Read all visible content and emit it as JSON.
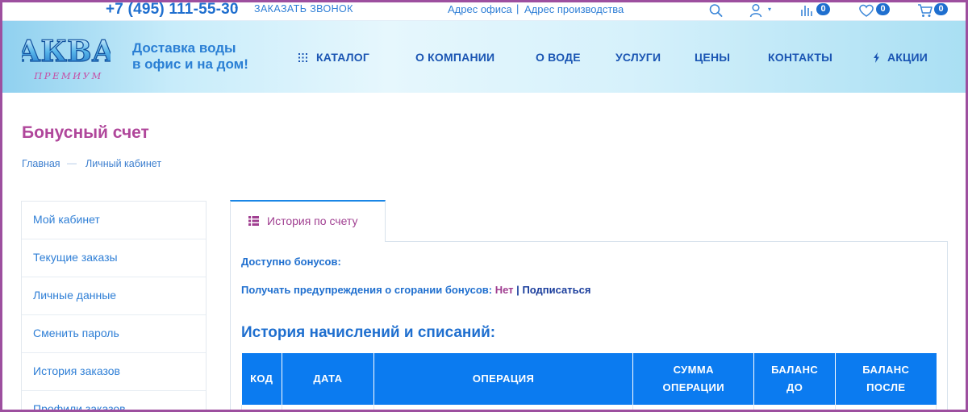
{
  "topbar": {
    "phone": "+7 (495) 111-55-30",
    "callback": "ЗАКАЗАТЬ ЗВОНОК",
    "office_address": "Адрес офиса",
    "address_separator": "|",
    "production_address": "Адрес производства",
    "compare_count": "0",
    "favorites_count": "0",
    "cart_count": "0",
    "icons": [
      "search-icon",
      "user-icon",
      "compare-icon",
      "heart-icon",
      "cart-icon"
    ]
  },
  "header": {
    "logo_text": "АКВА",
    "logo_subtext": "ПРЕМИУМ",
    "slogan_line1": "Доставка воды",
    "slogan_line2": "в офис и на дом!",
    "nav": {
      "catalog": "КАТАЛОГ",
      "about": "О КОМПАНИИ",
      "water": "О ВОДЕ",
      "services": "УСЛУГИ",
      "prices": "ЦЕНЫ",
      "contacts": "КОНТАКТЫ",
      "promo": "АКЦИИ"
    }
  },
  "page": {
    "title": "Бонусный счет",
    "breadcrumb": {
      "home": "Главная",
      "separator": "—",
      "cabinet": "Личный кабинет"
    }
  },
  "sidebar": {
    "items": [
      {
        "label": "Мой кабинет"
      },
      {
        "label": "Текущие заказы"
      },
      {
        "label": "Личные данные"
      },
      {
        "label": "Сменить пароль"
      },
      {
        "label": "История заказов"
      },
      {
        "label": "Профили заказов"
      }
    ]
  },
  "content": {
    "tab_label": "История по счету",
    "available_label": "Доступно бонусов:",
    "notify_label": "Получать предупреждения о сгорании бонусов:",
    "notify_value": "Нет",
    "notify_separator": "|",
    "subscribe_link": "Подписаться",
    "history_title": "История начислений и списаний:",
    "table_headers": {
      "code": "КОД",
      "date": "ДАТА",
      "operation": "ОПЕРАЦИЯ",
      "sum_line1": "СУММА",
      "sum_line2": "ОПЕРАЦИИ",
      "before_line1": "БАЛАНС",
      "before_line2": "ДО",
      "after_line1": "БАЛАНС",
      "after_line2": "ПОСЛЕ"
    }
  },
  "colors": {
    "accent": "#1f6fcf",
    "title_pink": "#b0479b",
    "table_header": "#0b7bf0",
    "frame": "#9d4f9f"
  }
}
